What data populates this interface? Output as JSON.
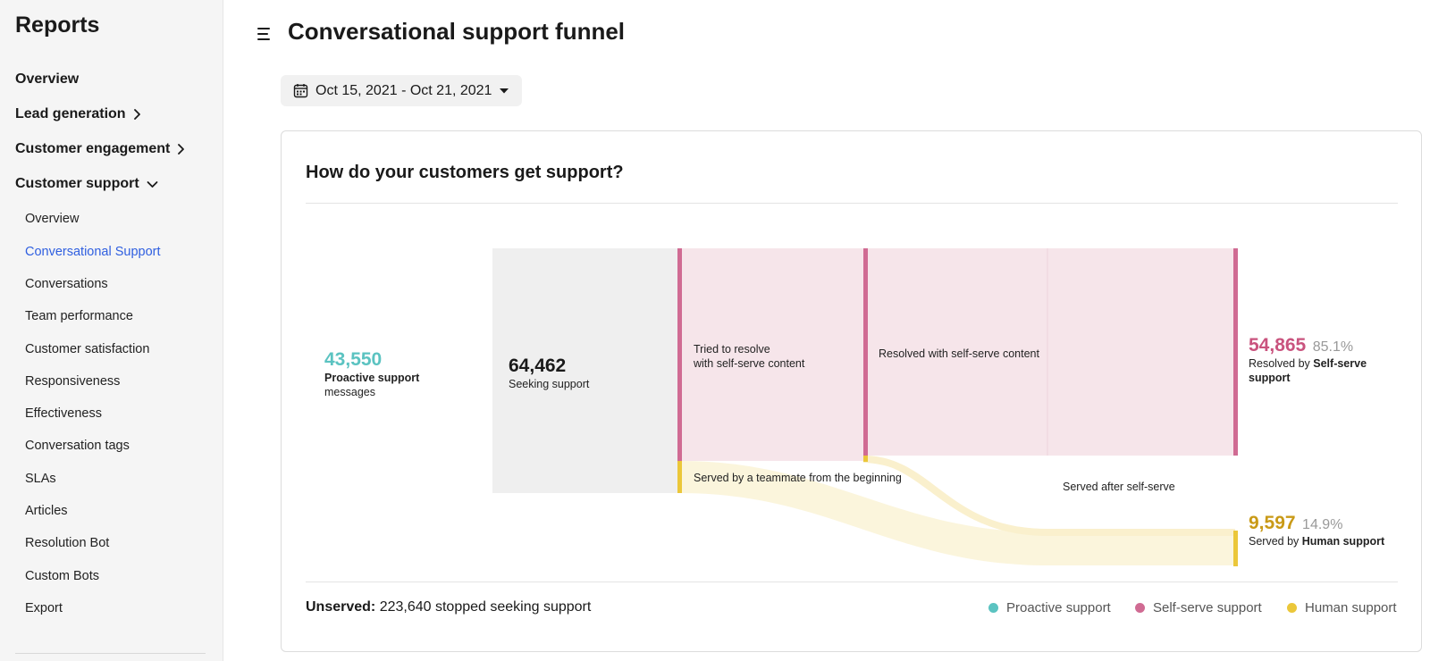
{
  "sidebar": {
    "title": "Reports",
    "top_items": [
      {
        "label": "Overview"
      },
      {
        "label": "Lead generation"
      },
      {
        "label": "Customer engagement"
      },
      {
        "label": "Customer support"
      }
    ],
    "sub_items": [
      {
        "label": "Overview"
      },
      {
        "label": "Conversational Support"
      },
      {
        "label": "Conversations"
      },
      {
        "label": "Team performance"
      },
      {
        "label": "Customer satisfaction"
      },
      {
        "label": "Responsiveness"
      },
      {
        "label": "Effectiveness"
      },
      {
        "label": "Conversation tags"
      },
      {
        "label": "SLAs"
      },
      {
        "label": "Articles"
      },
      {
        "label": "Resolution Bot"
      },
      {
        "label": "Custom Bots"
      },
      {
        "label": "Export"
      }
    ],
    "active_sub_item": "Conversational Support",
    "active_color": "#2f5fe0"
  },
  "header": {
    "title": "Conversational support funnel",
    "date_range": "Oct 15, 2021 - Oct 21, 2021"
  },
  "card": {
    "title": "How do your customers get support?",
    "proactive": {
      "value": "43,550",
      "label_bold": "Proactive support",
      "label_rest": "messages"
    },
    "seeking": {
      "value": "64,462",
      "label": "Seeking support"
    },
    "stage_labels": {
      "tried": "Tried to resolve",
      "tried_2": "with self-serve content",
      "resolved": "Resolved with self-serve content",
      "teammate": "Served by a teammate from the beginning",
      "after": "Served after self-serve"
    },
    "self_serve_result": {
      "value": "54,865",
      "percent": "85.1%",
      "label_prefix": "Resolved by ",
      "label_bold": "Self-serve support"
    },
    "human_result": {
      "value": "9,597",
      "percent": "14.9%",
      "label_prefix": "Served by ",
      "label_bold": "Human support"
    },
    "unserved_label": "Unserved:",
    "unserved_text": " 223,640 stopped seeking support",
    "legend": [
      {
        "label": "Proactive support",
        "color": "#5bc3c1"
      },
      {
        "label": "Self-serve support",
        "color": "#d06b93"
      },
      {
        "label": "Human support",
        "color": "#ebc73a"
      }
    ]
  },
  "colors": {
    "proactive": "#5bc3c1",
    "self_serve": "#c9537e",
    "self_serve_fill": "#f6e5ea",
    "human": "#c99a17",
    "human_bar": "#ebc73a",
    "human_fill": "#fbf4d8",
    "seeking_fill": "#efefef"
  }
}
